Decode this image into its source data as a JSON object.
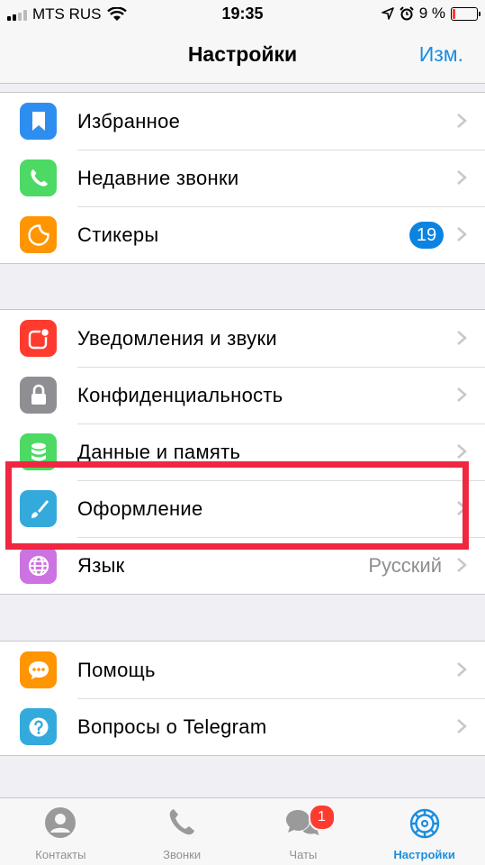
{
  "status_bar": {
    "carrier": "MTS RUS",
    "time": "19:35",
    "battery_percent": "9 %"
  },
  "nav": {
    "title": "Настройки",
    "edit_label": "Изм."
  },
  "group1": [
    {
      "label": "Избранное",
      "icon": "bookmark-icon",
      "color": "#2e8ef0"
    },
    {
      "label": "Недавние звонки",
      "icon": "phone-icon",
      "color": "#4cd964"
    },
    {
      "label": "Стикеры",
      "icon": "sticker-icon",
      "color": "#ff9500",
      "badge": "19"
    }
  ],
  "group2": [
    {
      "label": "Уведомления и звуки",
      "icon": "notification-icon",
      "color": "#ff3b30"
    },
    {
      "label": "Конфиденциальность",
      "icon": "lock-icon",
      "color": "#8e8e93"
    },
    {
      "label": "Данные и память",
      "icon": "database-icon",
      "color": "#4cd964"
    },
    {
      "label": "Оформление",
      "icon": "brush-icon",
      "color": "#34aadc"
    },
    {
      "label": "Язык",
      "icon": "globe-icon",
      "color": "#cc73e1",
      "value": "Русский"
    }
  ],
  "group3": [
    {
      "label": "Помощь",
      "icon": "chat-bubble-icon",
      "color": "#ff9500"
    },
    {
      "label": "Вопросы о Telegram",
      "icon": "question-icon",
      "color": "#34aadc"
    }
  ],
  "tabbar": {
    "tabs": [
      {
        "label": "Контакты",
        "icon": "contacts-icon"
      },
      {
        "label": "Звонки",
        "icon": "phone-icon"
      },
      {
        "label": "Чаты",
        "icon": "chats-icon",
        "badge": "1"
      },
      {
        "label": "Настройки",
        "icon": "settings-icon",
        "active": true
      }
    ]
  },
  "colors": {
    "accent": "#1a8ee0",
    "highlight": "#ef2741",
    "badge_red": "#ff3b30"
  }
}
